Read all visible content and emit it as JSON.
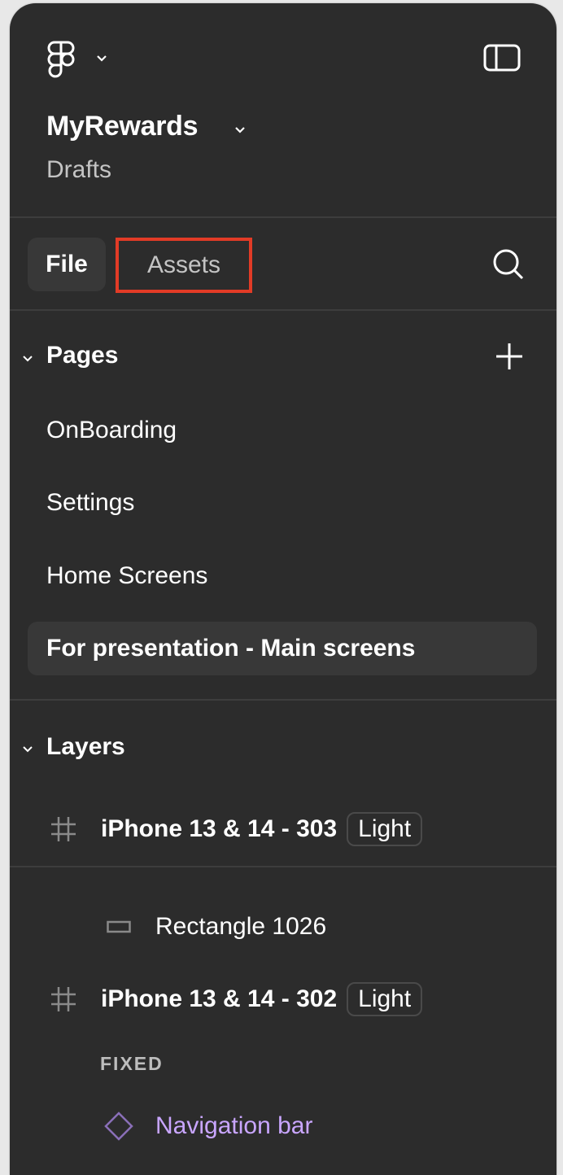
{
  "header": {
    "logo_icon": "figma-logo-icon",
    "file_name": "MyRewards",
    "location": "Drafts",
    "panel_toggle_icon": "sidebar-toggle-icon"
  },
  "tabs": [
    {
      "label": "File",
      "active": true
    },
    {
      "label": "Assets",
      "active": false,
      "highlighted": true
    }
  ],
  "highlight_color": "#e23b26",
  "search_icon": "search-icon",
  "pages": {
    "title": "Pages",
    "add_icon": "plus-icon",
    "items": [
      {
        "label": "OnBoarding",
        "active": false
      },
      {
        "label": "Settings",
        "active": false
      },
      {
        "label": "Home Screens",
        "active": false
      },
      {
        "label": "For presentation - Main screens",
        "active": true
      }
    ]
  },
  "layers": {
    "title": "Layers",
    "items": [
      {
        "type": "frame",
        "icon": "frame-icon",
        "name": "iPhone 13 & 14 - 303",
        "badge": "Light"
      },
      {
        "type": "rectangle",
        "icon": "rectangle-icon",
        "name": "Rectangle 1026"
      },
      {
        "type": "frame",
        "icon": "frame-icon",
        "name": "iPhone 13 & 14 - 302",
        "badge": "Light"
      },
      {
        "type": "section-label",
        "name": "FIXED"
      },
      {
        "type": "component",
        "icon": "component-instance-icon",
        "name": "Navigation bar",
        "color": "#c9a6ff"
      }
    ]
  }
}
